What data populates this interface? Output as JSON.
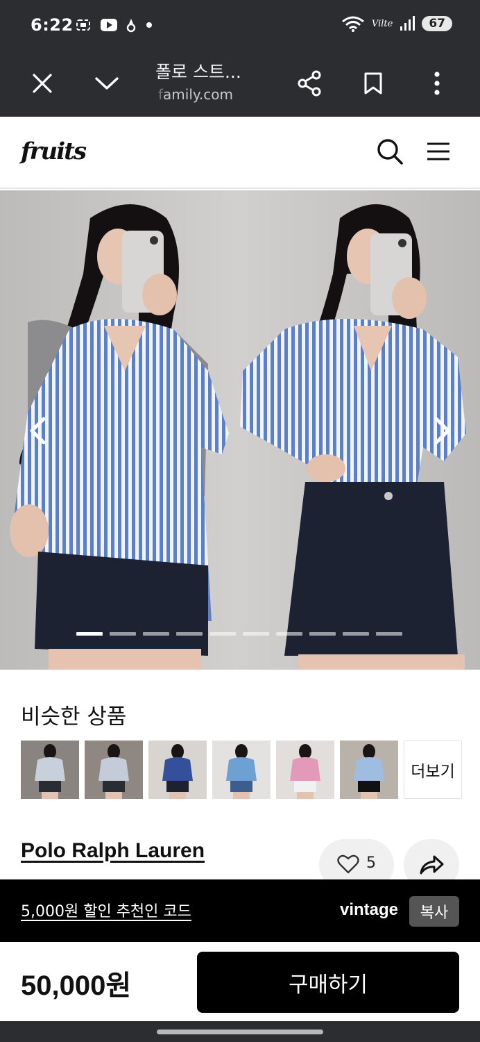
{
  "status_bar": {
    "time": "6:22",
    "lte": "Vilte",
    "battery": "67",
    "icons_left": [
      "screenshot-icon",
      "youtube-icon",
      "notification-icon",
      "dot-icon"
    ],
    "icons_right": [
      "wifi-icon",
      "signal-icon",
      "battery-icon"
    ]
  },
  "browser": {
    "title": "폴로 스트...",
    "url_faded": "f",
    "url_rest": "amily.com",
    "icons": [
      "close-icon",
      "chevron-down-icon",
      "share-icon",
      "bookmark-icon",
      "more-vert-icon"
    ]
  },
  "header": {
    "logo": "fruits",
    "icons": [
      "search-icon",
      "menu-icon"
    ]
  },
  "gallery": {
    "slide_count": 10,
    "active_index": 0,
    "icons": [
      "chevron-left-icon",
      "chevron-right-icon"
    ]
  },
  "similar": {
    "title": "비슷한 상품",
    "more_label": "더보기",
    "thumb_colors": [
      {
        "bg": "#8a8480",
        "shirt": "#c8d0dc",
        "bottom": "#2a2c34"
      },
      {
        "bg": "#8f8882",
        "shirt": "#c4ccd9",
        "bottom": "#2a2c34"
      },
      {
        "bg": "#d8d4d0",
        "shirt": "#34509a",
        "bottom": "#1e2230"
      },
      {
        "bg": "#e4e2e0",
        "shirt": "#6fa0d4",
        "bottom": "#3a5f8f"
      },
      {
        "bg": "#e2dedc",
        "shirt": "#e39ab8",
        "bottom": "#f1f1f1"
      },
      {
        "bg": "#b8b2aa",
        "shirt": "#9fbde0",
        "bottom": "#111111"
      }
    ]
  },
  "product": {
    "brand": "Polo Ralph Lauren",
    "likes": "5",
    "price": "50,000원",
    "buy_label": "구매하기"
  },
  "referral": {
    "text": "5,000원 할인 추천인 코드",
    "code": "vintage",
    "copy_label": "복사"
  },
  "colors": {
    "system_bar": "#2b2d30",
    "shirt_blue": "#5f7fc4",
    "denim": "#1d2233",
    "wall": "#c9c7c6"
  }
}
